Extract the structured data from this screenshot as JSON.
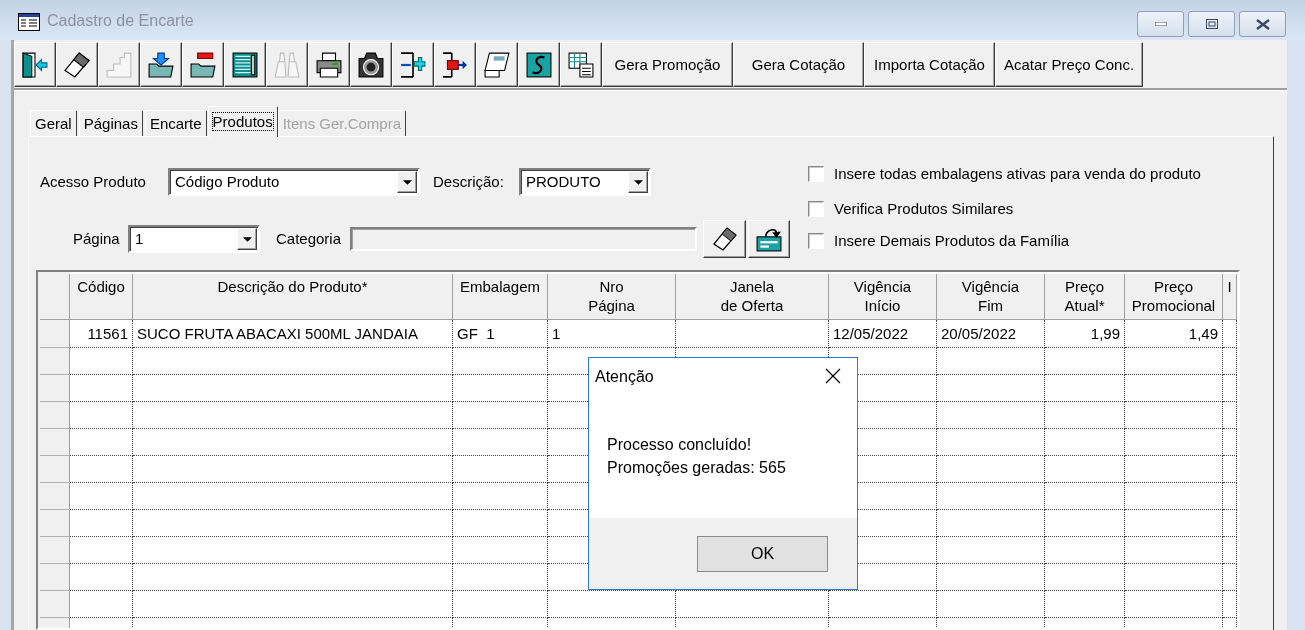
{
  "window": {
    "title": "Cadastro de Encarte",
    "active": false
  },
  "toolbar": {
    "icon_buttons": [
      {
        "disabled": false
      },
      {
        "disabled": false
      },
      {
        "disabled": true
      },
      {
        "disabled": false
      },
      {
        "disabled": false
      },
      {
        "disabled": false
      },
      {
        "disabled": true
      },
      {
        "disabled": false
      },
      {
        "disabled": false
      },
      {
        "disabled": false
      },
      {
        "disabled": false
      },
      {
        "disabled": false
      },
      {
        "disabled": false
      },
      {
        "disabled": false
      }
    ],
    "text_buttons": [
      "Gera Promoção",
      "Gera Cotação",
      "Importa Cotação",
      "Acatar Preço Conc."
    ]
  },
  "tabs": [
    {
      "label": "Geral",
      "selected": false,
      "disabled": false
    },
    {
      "label": "Páginas",
      "selected": false,
      "disabled": false
    },
    {
      "label": "Encarte",
      "selected": false,
      "disabled": false
    },
    {
      "label": "Produtos",
      "selected": true,
      "disabled": false
    },
    {
      "label": "Itens Ger.Compra",
      "selected": false,
      "disabled": true
    }
  ],
  "form": {
    "fields": [
      {
        "label": "Acesso Produto",
        "value": "Código Produto",
        "kind": "dropdown"
      },
      {
        "label": "Descrição:",
        "value": "PRODUTO",
        "kind": "dropdown"
      },
      {
        "label": "Página",
        "value": "1",
        "kind": "dropdown"
      },
      {
        "label": "Categoria",
        "kind": "readonly"
      }
    ],
    "options": [
      {
        "label": "Insere todas embalagens ativas para venda do produto",
        "checked": false
      },
      {
        "label": "Verifica Produtos Similares",
        "checked": false
      },
      {
        "label": "Insere Demais Produtos da Família",
        "checked": false
      }
    ]
  },
  "grid": {
    "columns": [
      {
        "label": "Código",
        "kind": "number"
      },
      {
        "label": "Descrição do Produto*",
        "kind": "text"
      },
      {
        "label": "Embalagem",
        "kind": "text"
      },
      {
        "label": "Nro\nPágina",
        "kind": "text"
      },
      {
        "label": "Janela\nde Oferta",
        "kind": "text"
      },
      {
        "label": "Vigência\nInício",
        "kind": "text"
      },
      {
        "label": "Vigência\nFim",
        "kind": "text"
      },
      {
        "label": "Preço\nAtual*",
        "kind": "number"
      },
      {
        "label": "Preço\nPromocional",
        "kind": "number"
      },
      {
        "label": "I",
        "kind": "text"
      }
    ],
    "rows": [
      {
        "cells": [
          "11561",
          "SUCO FRUTA ABACAXI 500ML JANDAIA",
          "GF  1",
          "1",
          null,
          "12/05/2022",
          "20/05/2022",
          "1,99",
          "1,49",
          null
        ]
      }
    ]
  },
  "dialog": {
    "title": "Atenção",
    "message": [
      "Processo concluído!",
      "Promoções geradas: 565"
    ],
    "button": "OK"
  }
}
